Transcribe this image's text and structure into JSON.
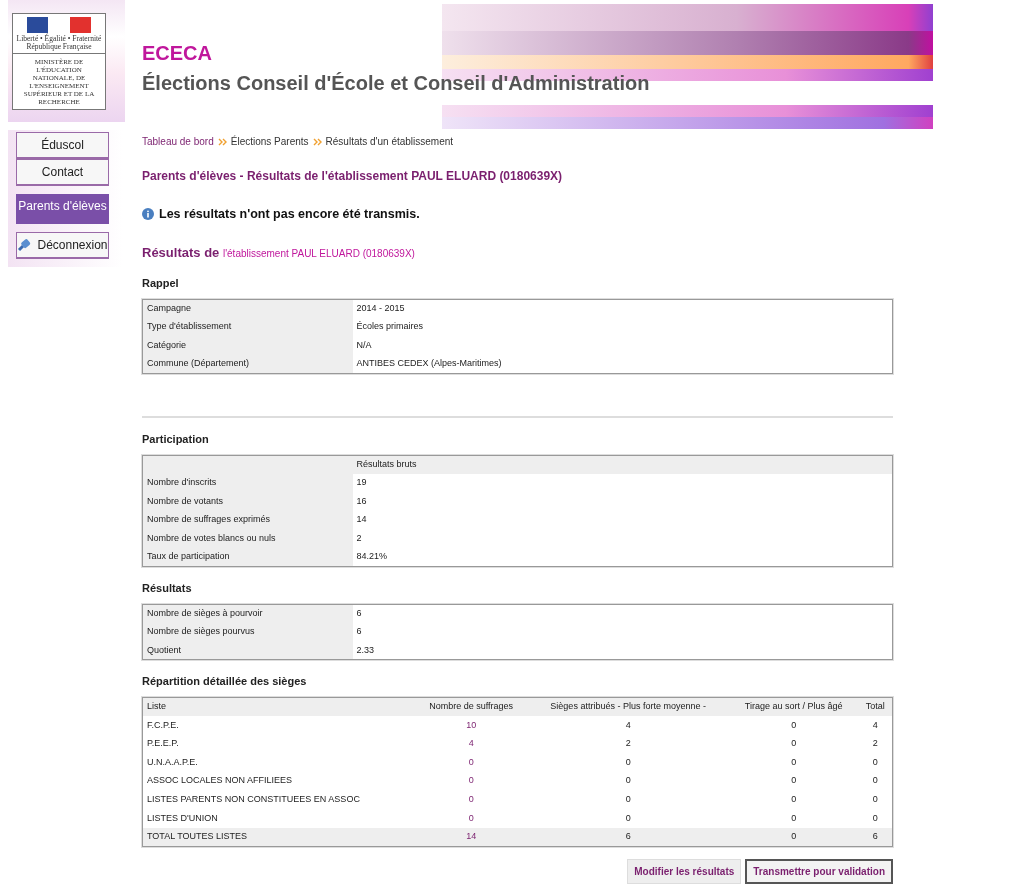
{
  "logo": {
    "motto": "Liberté • Égalité • Fraternité",
    "republic": "République Française",
    "ministry": "MINISTÈRE DE L'ÉDUCATION NATIONALE, DE L'ENSEIGNEMENT SUPÉRIEUR ET DE LA RECHERCHE"
  },
  "header": {
    "app_name": "ECECA",
    "title": "Élections Conseil d'École et Conseil d'Administration"
  },
  "sidebar": {
    "items": [
      {
        "label": "Éduscol",
        "kind": "link",
        "selected": false
      },
      {
        "label": "Contact",
        "kind": "link",
        "selected": false
      },
      {
        "label": "Parents d'élèves",
        "kind": "link",
        "selected": true
      },
      {
        "label": "Déconnexion",
        "kind": "logout",
        "selected": false
      }
    ]
  },
  "breadcrumb": [
    "Tableau de bord",
    "Élections Parents",
    "Résultats d'un établissement"
  ],
  "page_title": "Parents d'élèves - Résultats de l'établissement PAUL ELUARD (0180639X)",
  "notice": "Les résultats n'ont pas encore été transmis.",
  "results_heading": {
    "prefix": "Résultats de",
    "name": "l'établissement PAUL ELUARD (0180639X)"
  },
  "rappel": {
    "title": "Rappel",
    "rows": [
      {
        "label": "Campagne",
        "value": "2014 - 2015"
      },
      {
        "label": "Type d'établissement",
        "value": "Écoles primaires"
      },
      {
        "label": "Catégorie",
        "value": "N/A"
      },
      {
        "label": "Commune (Département)",
        "value": "ANTIBES CEDEX (Alpes-Maritimes)"
      }
    ]
  },
  "participation": {
    "title": "Participation",
    "column": "Résultats bruts",
    "rows": [
      {
        "label": "Nombre d'inscrits",
        "value": "19"
      },
      {
        "label": "Nombre de votants",
        "value": "16"
      },
      {
        "label": "Nombre de suffrages exprimés",
        "value": "14"
      },
      {
        "label": "Nombre de votes blancs ou nuls",
        "value": "2"
      },
      {
        "label": "Taux de participation",
        "value": "84.21%"
      }
    ]
  },
  "resultats": {
    "title": "Résultats",
    "rows": [
      {
        "label": "Nombre de sièges à pourvoir",
        "value": "6"
      },
      {
        "label": "Nombre de sièges pourvus",
        "value": "6"
      },
      {
        "label": "Quotient",
        "value": "2.33"
      }
    ]
  },
  "repartition": {
    "title": "Répartition détaillée des sièges",
    "columns": [
      "Liste",
      "Nombre de suffrages",
      "Sièges attribués - Plus forte moyenne -",
      "Tirage au sort / Plus âgé",
      "Total"
    ],
    "rows": [
      {
        "kind": "list",
        "cells": [
          "F.C.P.E.",
          "10",
          "4",
          "0",
          "4"
        ]
      },
      {
        "kind": "list",
        "cells": [
          "P.E.E.P.",
          "4",
          "2",
          "0",
          "2"
        ]
      },
      {
        "kind": "list",
        "cells": [
          "U.N.A.A.P.E.",
          "0",
          "0",
          "0",
          "0"
        ]
      },
      {
        "kind": "list",
        "cells": [
          "ASSOC LOCALES NON AFFILIEES",
          "0",
          "0",
          "0",
          "0"
        ]
      },
      {
        "kind": "list",
        "cells": [
          "LISTES PARENTS NON CONSTITUEES EN ASSOC",
          "0",
          "0",
          "0",
          "0"
        ]
      },
      {
        "kind": "list",
        "cells": [
          "LISTES D'UNION",
          "0",
          "0",
          "0",
          "0"
        ]
      },
      {
        "kind": "total",
        "cells": [
          "TOTAL TOUTES LISTES",
          "14",
          "6",
          "0",
          "6"
        ]
      }
    ]
  },
  "buttons": [
    {
      "label": "Modifier les résultats",
      "kind": "secondary"
    },
    {
      "label": "Transmettre pour validation",
      "kind": "primary"
    }
  ]
}
